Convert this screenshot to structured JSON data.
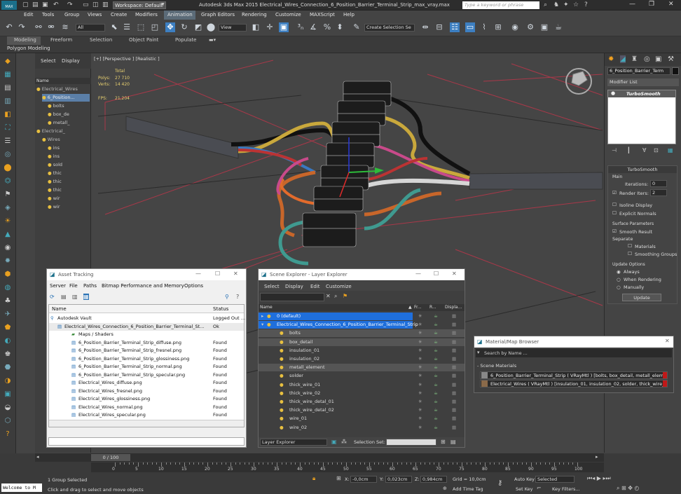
{
  "titlebar": {
    "app_logo": "MAX",
    "workspace": "Workspace: Default",
    "title": "Autodesk 3ds Max  2015    Electrical_Wires_Connection_6_Position_Barrier_Terminal_Strip_max_vray.max",
    "search_placeholder": "Type a keyword or phrase"
  },
  "menu": [
    "Edit",
    "Tools",
    "Group",
    "Views",
    "Create",
    "Modifiers",
    "Animation",
    "Graph Editors",
    "Rendering",
    "Customize",
    "MAXScript",
    "Help"
  ],
  "toolbar": {
    "selection_filter": "All",
    "view_dropdown": "View",
    "named_selection": "Create Selection Se"
  },
  "ribbon": {
    "tabs": [
      "Modeling",
      "Freeform",
      "Selection",
      "Object Paint",
      "Populate"
    ],
    "subtab": "Polygon Modeling"
  },
  "scene_explorer_left": {
    "tabs": [
      "Select",
      "Display"
    ],
    "header": "Name",
    "items": [
      "Electrical_Wires",
      "6_Position...",
      "bolts",
      "box_de",
      "metall_",
      "Electrical_",
      "Wires",
      "ins",
      "ins",
      "sold",
      "thic",
      "thic",
      "thic",
      "wir",
      "wir"
    ]
  },
  "viewport": {
    "label": "[+] [Perspective ] [Realistic ]",
    "stats": {
      "total_label": "Total",
      "polys_label": "Polys:",
      "polys": "27 710",
      "verts_label": "Verts:",
      "verts": "14 420",
      "fps_label": "FPS:",
      "fps": "21,204"
    }
  },
  "command_panel": {
    "object_name": "6_Position_Barrier_Term",
    "modifier_list": "Modifier List",
    "modifier": "TurboSmooth",
    "rollout_title": "TurboSmooth",
    "main": "Main",
    "iterations_label": "Iterations:",
    "iterations": "0",
    "render_iters_label": "Render Iters:",
    "render_iters": "2",
    "isoline": "Isoline Display",
    "explicit_normals": "Explicit Normals",
    "surface_params": "Surface Parameters",
    "smooth_result": "Smooth Result",
    "separate": "Separate",
    "materials": "Materials",
    "smoothing_groups": "Smoothing Groups",
    "update_options": "Update Options",
    "always": "Always",
    "when_rendering": "When Rendering",
    "manually": "Manually",
    "update_button": "Update"
  },
  "asset_tracking": {
    "title": "Asset Tracking",
    "menu": [
      "Server",
      "File",
      "Paths",
      "Bitmap Performance and Memory",
      "Options"
    ],
    "col_name": "Name",
    "col_status": "Status",
    "rows": [
      {
        "name": "Autodesk Vault",
        "status": "Logged Out ..."
      },
      {
        "name": "Electrical_Wires_Connection_6_Position_Barrier_Terminal_St...",
        "status": "Ok"
      },
      {
        "name": "Maps / Shaders",
        "status": ""
      },
      {
        "name": "6_Position_Barrier_Terminal_Strip_diffuse.png",
        "status": "Found"
      },
      {
        "name": "6_Position_Barrier_Terminal_Strip_fresnel.png",
        "status": "Found"
      },
      {
        "name": "6_Position_Barrier_Terminal_Strip_glossiness.png",
        "status": "Found"
      },
      {
        "name": "6_Position_Barrier_Terminal_Strip_normal.png",
        "status": "Found"
      },
      {
        "name": "6_Position_Barrier_Terminal_Strip_specular.png",
        "status": "Found"
      },
      {
        "name": "Electrical_Wires_diffuse.png",
        "status": "Found"
      },
      {
        "name": "Electrical_Wires_fresnel.png",
        "status": "Found"
      },
      {
        "name": "Electrical_Wires_glossiness.png",
        "status": "Found"
      },
      {
        "name": "Electrical_Wires_normal.png",
        "status": "Found"
      },
      {
        "name": "Electrical_Wires_specular.png",
        "status": "Found"
      }
    ]
  },
  "layer_explorer": {
    "title": "Scene Explorer - Layer Explorer",
    "menu": [
      "Select",
      "Display",
      "Edit",
      "Customize"
    ],
    "col_name": "Name",
    "col_fr": "Fr...",
    "col_r": "R...",
    "col_disp": "Displa...",
    "rows": [
      "0 (default)",
      "Electrical_Wires_Connection_6_Position_Barrier_Terminal_Strip",
      "bolts",
      "box_detail",
      "insulation_01",
      "insulation_02",
      "metall_element",
      "solder",
      "thick_wire_01",
      "thick_wire_02",
      "thick_wire_detal_01",
      "thick_wire_detal_02",
      "wire_01",
      "wire_02"
    ],
    "footer_dropdown": "Layer Explorer",
    "selection_set_label": "Selection Set:"
  },
  "material_browser": {
    "title": "Material/Map Browser",
    "search_placeholder": "Search by Name ...",
    "section": "- Scene Materials",
    "items": [
      "6_Position_Barrier_Terminal_Strip  ( VRayMtl ) [bolts, box_detail, metall_eleme...",
      "Electrical_Wires  ( VRayMtl ) [insulation_01, insulation_02, solder, thick_wire_0..."
    ]
  },
  "timeline": {
    "frame_counter": "0 / 100",
    "ticks": [
      "0",
      "5",
      "10",
      "15",
      "20",
      "25",
      "30",
      "35",
      "40",
      "45",
      "50",
      "55",
      "60",
      "65",
      "70",
      "75",
      "80",
      "85",
      "90",
      "95",
      "100"
    ]
  },
  "status": {
    "welcome": "Welcome to M",
    "selection": "1 Group Selected",
    "hint": "Click and drag to select and move objects",
    "x_label": "X:",
    "x": "-0,0cm",
    "y_label": "Y:",
    "y": "0,023cm",
    "z_label": "Z:",
    "z": "0,984cm",
    "grid": "Grid = 10,0cm",
    "add_time_tag": "Add Time Tag",
    "auto_key": "Auto Key",
    "selected": "Selected",
    "set_key": "Set Key",
    "key_filters": "Key Filters..."
  }
}
